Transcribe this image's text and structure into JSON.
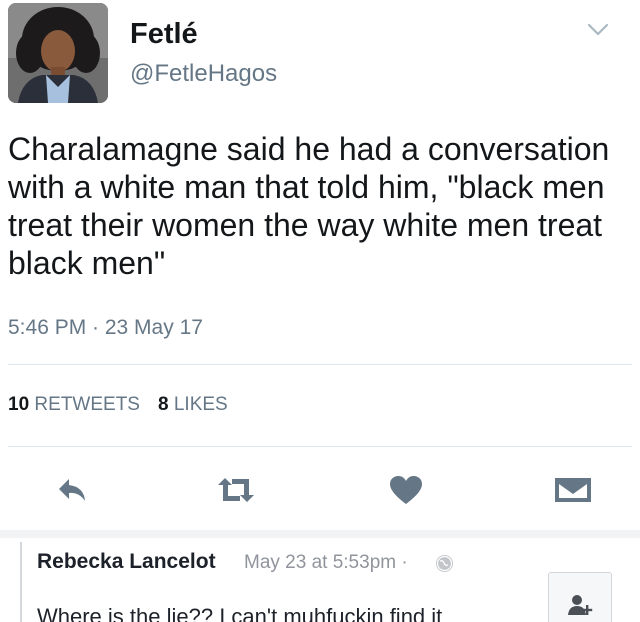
{
  "tweet": {
    "display_name": "Fetlé",
    "handle": "@FetleHagos",
    "text": "Charalamagne said he had a conversation with a white man that told him, \"black men treat their women the way white men treat black men\"",
    "timestamp": "5:46 PM · 23 May 17",
    "retweet_count": "10",
    "retweet_label": "RETWEETS",
    "like_count": "8",
    "like_label": "LIKES"
  },
  "icons": {
    "caret": "chevron-down-icon",
    "reply": "reply-icon",
    "retweet": "retweet-icon",
    "like": "heart-icon",
    "dm": "envelope-icon",
    "privacy": "globe-icon",
    "add_friend": "add-friend-icon"
  },
  "colors": {
    "action_icon": "#657786",
    "muted_text": "#657786",
    "comment_meta": "#90949c"
  },
  "comment": {
    "author": "Rebecka Lancelot",
    "meta": "May 23 at 5:53pm ·",
    "text": "Where is the lie?? I can't muhfuckin find it"
  }
}
